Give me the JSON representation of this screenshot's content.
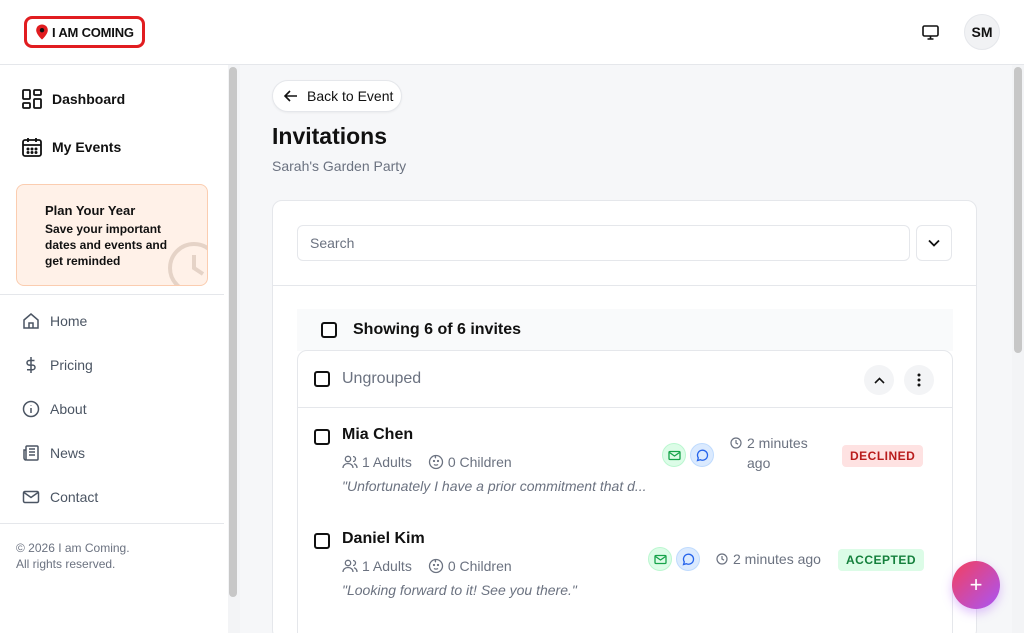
{
  "header": {
    "logo_text": "I AM COMING",
    "avatar_initials": "SM",
    "brand_color": "#e11d20"
  },
  "sidebar": {
    "main_items": [
      {
        "label": "Dashboard",
        "icon": "dashboard-grid-icon"
      },
      {
        "label": "My Events",
        "icon": "calendar-icon"
      }
    ],
    "promo": {
      "title": "Plan Your Year",
      "text": "Save your important dates and events and get reminded",
      "icon": "clock-icon"
    },
    "sub_items": [
      {
        "label": "Home",
        "icon": "home-icon"
      },
      {
        "label": "Pricing",
        "icon": "dollar-icon"
      },
      {
        "label": "About",
        "icon": "info-icon"
      },
      {
        "label": "News",
        "icon": "newspaper-icon"
      },
      {
        "label": "Contact",
        "icon": "mail-icon"
      }
    ],
    "copyright_line1": "© 2026 I am Coming.",
    "copyright_line2": "All rights reserved."
  },
  "main": {
    "back_label": "Back to Event",
    "title": "Invitations",
    "subtitle": "Sarah's Garden Party",
    "search_placeholder": "Search",
    "showing_text": "Showing 6 of 6 invites",
    "group": {
      "title": "Ungrouped"
    },
    "invites": [
      {
        "name": "Mia Chen",
        "adults": "1 Adults",
        "children": "0 Children",
        "note": "\"Unfortunately I have a prior commitment that d...",
        "time": "2 minutes ago",
        "time_line1": "2 minutes",
        "time_line2": "ago",
        "status": "DECLINED",
        "status_color": "#b91c1c"
      },
      {
        "name": "Daniel Kim",
        "adults": "1 Adults",
        "children": "0 Children",
        "note": "\"Looking forward to it! See you there.\"",
        "time": "2 minutes ago",
        "status": "ACCEPTED",
        "status_color": "#15803d"
      }
    ]
  },
  "fab_label": "+"
}
